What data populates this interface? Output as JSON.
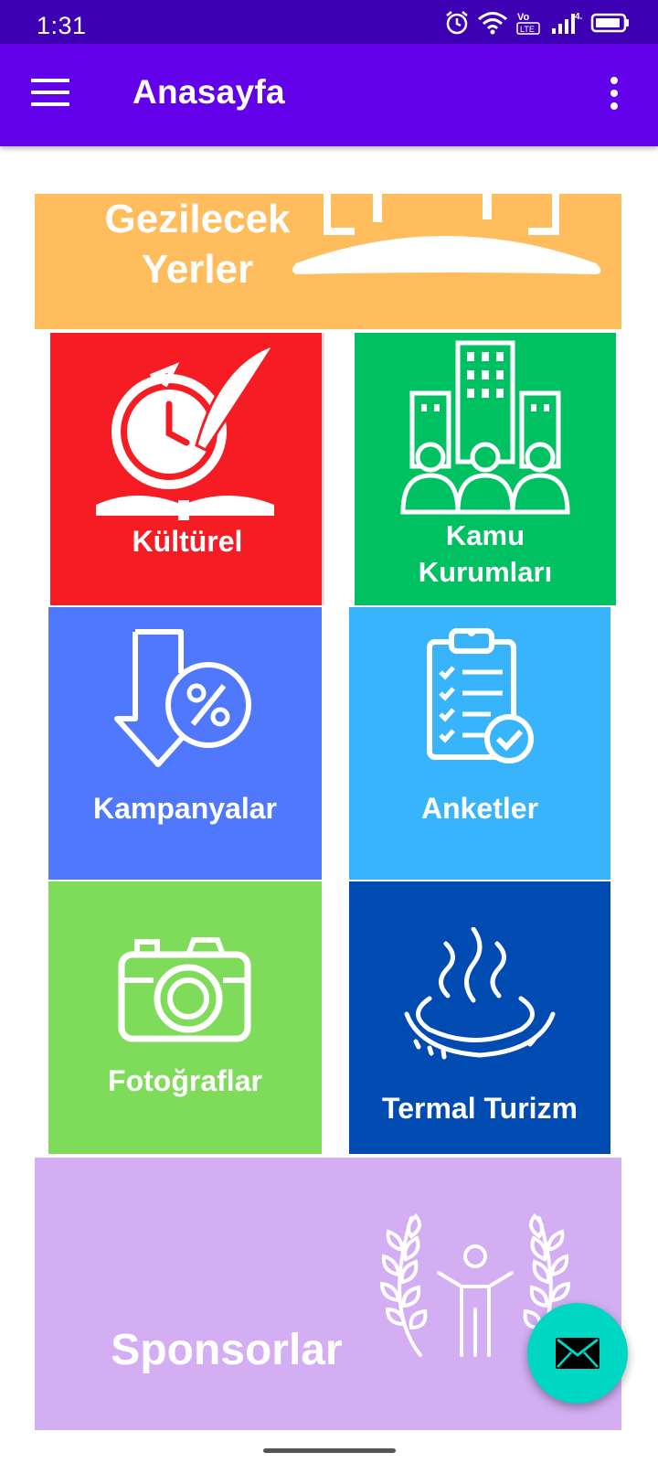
{
  "status": {
    "time": "1:31",
    "network": "4.5G",
    "volte": "Vo LTE"
  },
  "appbar": {
    "title": "Anasayfa",
    "menu_icon": "hamburger-menu-icon",
    "overflow_icon": "more-vert-icon"
  },
  "tiles": {
    "gezilecek": {
      "label": "Gezilecek Yerler",
      "color": "#ffbd5e"
    },
    "kulturel": {
      "label": "Kültürel",
      "color": "#f51c24"
    },
    "kamu": {
      "label": "Kamu Kurumları",
      "color": "#00c161"
    },
    "kampanya": {
      "label": "Kampanyalar",
      "color": "#4f78fc"
    },
    "anket": {
      "label": "Anketler",
      "color": "#38b4fd"
    },
    "foto": {
      "label": "Fotoğraflar",
      "color": "#7fdb5a"
    },
    "termal": {
      "label": "Termal Turizm",
      "color": "#004bb2"
    },
    "sponsor": {
      "label": "Sponsorlar",
      "color": "#d3aef3"
    }
  },
  "fab": {
    "icon": "mail-icon",
    "color": "#00d6c4"
  }
}
